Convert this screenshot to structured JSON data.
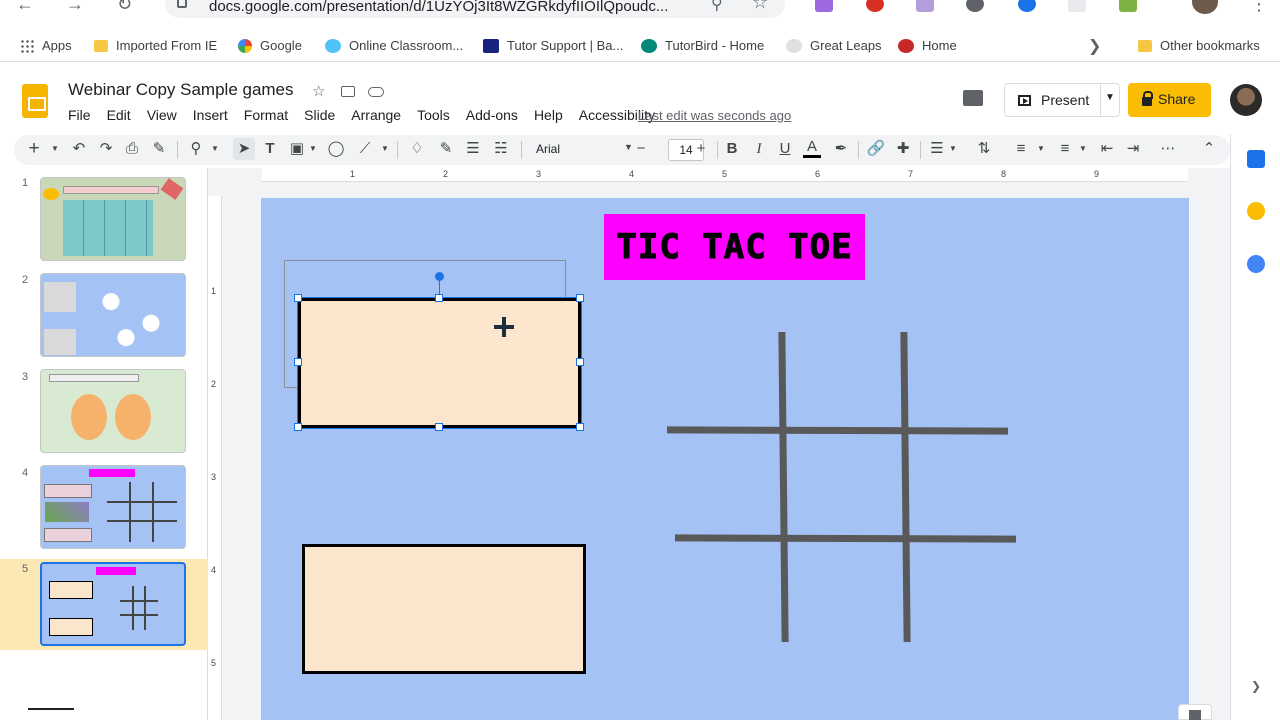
{
  "browser": {
    "url": "docs.google.com/presentation/d/1UzYOj3It8WZGRkdyfIIOIlQpoudc...",
    "bookmarks": [
      {
        "label": "Apps",
        "icon": "apps-icon"
      },
      {
        "label": "Imported From IE",
        "icon": "folder-icon"
      },
      {
        "label": "Google",
        "icon": "google-icon"
      },
      {
        "label": "Online Classroom...",
        "icon": "classroom-icon"
      },
      {
        "label": "Tutor Support | Ba...",
        "icon": "tutor-support-icon"
      },
      {
        "label": "TutorBird - Home",
        "icon": "tutorbird-icon"
      },
      {
        "label": "Great Leaps",
        "icon": "great-leaps-icon"
      },
      {
        "label": "Home",
        "icon": "home-w-icon"
      }
    ],
    "other_bookmarks": "Other bookmarks"
  },
  "doc": {
    "title": "Webinar Copy Sample games",
    "menu": [
      "File",
      "Edit",
      "View",
      "Insert",
      "Format",
      "Slide",
      "Arrange",
      "Tools",
      "Add-ons",
      "Help",
      "Accessibility"
    ],
    "last_edit": "Last edit was seconds ago",
    "present_label": "Present",
    "share_label": "Share"
  },
  "toolbar": {
    "font": "Arial",
    "font_size": "14",
    "bold": "B",
    "italic": "I",
    "underline": "U",
    "text_color": "A"
  },
  "filmstrip": {
    "slides": [
      "1",
      "2",
      "3",
      "4",
      "5"
    ],
    "selected": 5
  },
  "rulers": {
    "horizontal": [
      "1",
      "1",
      "2",
      "3",
      "4",
      "5",
      "6",
      "7",
      "8",
      "9"
    ],
    "vertical": [
      "1",
      "2",
      "3",
      "4",
      "5"
    ]
  },
  "slide": {
    "title": "TIC TAC TOE",
    "colors": {
      "background": "#a4c2f4",
      "title_bg": "#ff00ff",
      "box_fill": "#fce5cd",
      "grid": "#595959"
    }
  }
}
